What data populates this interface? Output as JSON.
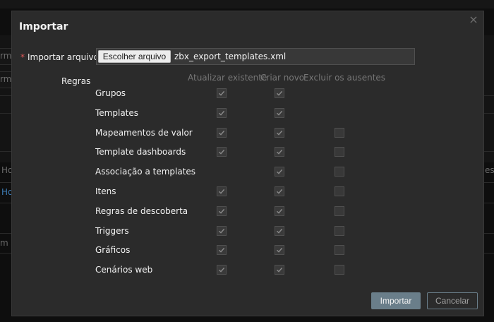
{
  "background": {
    "left_fragments": [
      "rme",
      "rme",
      "Ho",
      "Ho",
      "m r"
    ],
    "right_fragments": [
      "es"
    ]
  },
  "modal": {
    "title": "Importar",
    "close_icon": "close-icon",
    "file": {
      "label": "Importar arquivo",
      "required_mark": "*",
      "button_label": "Escolher arquivo",
      "file_name": "zbx_export_templates.xml"
    },
    "rules": {
      "label": "Regras",
      "columns": [
        "Atualizar existente",
        "Criar novo",
        "Excluir os ausentes"
      ],
      "rows": [
        {
          "name": "Grupos",
          "update": true,
          "create": true,
          "delete": null
        },
        {
          "name": "Templates",
          "update": true,
          "create": true,
          "delete": null
        },
        {
          "name": "Mapeamentos de valor",
          "update": true,
          "create": true,
          "delete": false
        },
        {
          "name": "Template dashboards",
          "update": true,
          "create": true,
          "delete": false
        },
        {
          "name": "Associação a templates",
          "update": null,
          "create": true,
          "delete": false
        },
        {
          "name": "Itens",
          "update": true,
          "create": true,
          "delete": false
        },
        {
          "name": "Regras de descoberta",
          "update": true,
          "create": true,
          "delete": false
        },
        {
          "name": "Triggers",
          "update": true,
          "create": true,
          "delete": false
        },
        {
          "name": "Gráficos",
          "update": true,
          "create": true,
          "delete": false
        },
        {
          "name": "Cenários web",
          "update": true,
          "create": true,
          "delete": false
        }
      ]
    },
    "buttons": {
      "import_label": "Importar",
      "cancel_label": "Cancelar"
    }
  }
}
